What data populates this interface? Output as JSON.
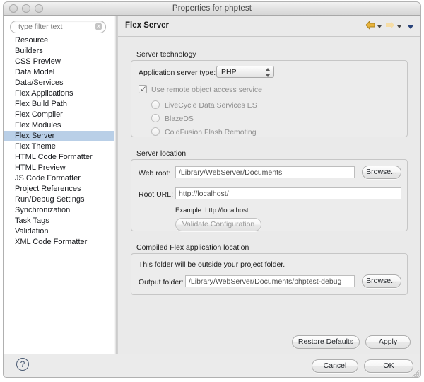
{
  "window": {
    "title": "Properties for phptest",
    "traffic_lights": [
      "close",
      "minimize",
      "zoom"
    ]
  },
  "sidebar": {
    "filter": {
      "placeholder": "type filter text",
      "value": "",
      "clear_glyph": "✕"
    },
    "items": [
      {
        "label": "Resource",
        "selected": false
      },
      {
        "label": "Builders",
        "selected": false
      },
      {
        "label": "CSS Preview",
        "selected": false
      },
      {
        "label": "Data Model",
        "selected": false
      },
      {
        "label": "Data/Services",
        "selected": false
      },
      {
        "label": "Flex Applications",
        "selected": false
      },
      {
        "label": "Flex Build Path",
        "selected": false
      },
      {
        "label": "Flex Compiler",
        "selected": false
      },
      {
        "label": "Flex Modules",
        "selected": false
      },
      {
        "label": "Flex Server",
        "selected": true
      },
      {
        "label": "Flex Theme",
        "selected": false
      },
      {
        "label": "HTML Code Formatter",
        "selected": false
      },
      {
        "label": "HTML Preview",
        "selected": false
      },
      {
        "label": "JS Code Formatter",
        "selected": false
      },
      {
        "label": "Project References",
        "selected": false
      },
      {
        "label": "Run/Debug Settings",
        "selected": false
      },
      {
        "label": "Synchronization",
        "selected": false
      },
      {
        "label": "Task Tags",
        "selected": false
      },
      {
        "label": "Validation",
        "selected": false
      },
      {
        "label": "XML Code Formatter",
        "selected": false
      }
    ]
  },
  "page": {
    "title": "Flex Server",
    "nav": {
      "back_icon": "back-arrow-icon",
      "forward_icon": "forward-arrow-icon",
      "menu_icon": "chevron-down-icon",
      "back_color": "#e8b33c",
      "forward_color": "#f3d79a",
      "menu_color": "#29437a"
    }
  },
  "server_technology": {
    "group_label": "Server technology",
    "app_server_type_label": "Application server type:",
    "app_server_type_value": "PHP",
    "app_server_type_options": [
      "PHP"
    ],
    "remote_object_checkbox": {
      "label": "Use remote object access service",
      "checked": true,
      "enabled": false,
      "check_glyph": "✓"
    },
    "radios": [
      {
        "label": "LiveCycle Data Services ES",
        "selected": false,
        "enabled": false
      },
      {
        "label": "BlazeDS",
        "selected": false,
        "enabled": false
      },
      {
        "label": "ColdFusion Flash Remoting",
        "selected": false,
        "enabled": false
      }
    ]
  },
  "server_location": {
    "group_label": "Server location",
    "web_root_label": "Web root:",
    "web_root_value": "/Library/WebServer/Documents",
    "web_root_browse": "Browse...",
    "root_url_label": "Root URL:",
    "root_url_value": "http://localhost/",
    "example_text": "Example: http://localhost",
    "validate_button": "Validate Configuration"
  },
  "compiled_location": {
    "group_label": "Compiled Flex application location",
    "note": "This folder will be outside your project folder.",
    "output_folder_label": "Output folder:",
    "output_folder_value": "/Library/WebServer/Documents/phptest-debug",
    "output_browse": "Browse..."
  },
  "page_buttons": {
    "restore_defaults": "Restore Defaults",
    "apply": "Apply"
  },
  "dialog_buttons": {
    "help_glyph": "?",
    "cancel": "Cancel",
    "ok": "OK"
  }
}
